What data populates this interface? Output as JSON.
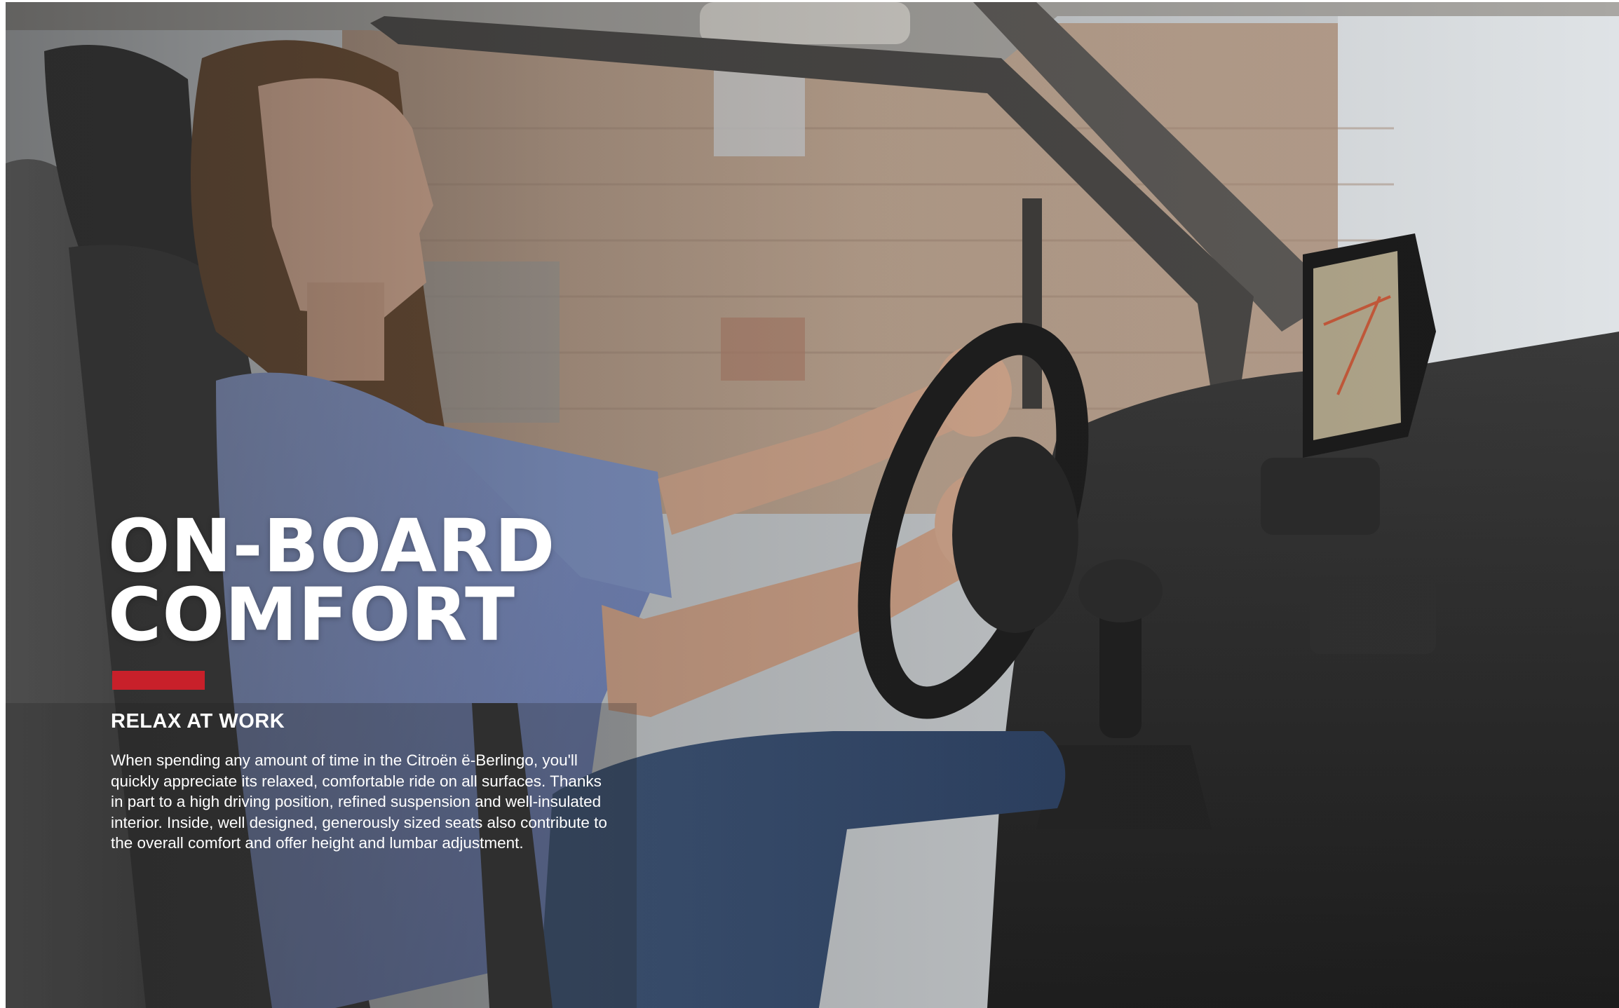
{
  "headline": {
    "line1": "ON-BOARD",
    "line2": "COMFORT"
  },
  "accent_color": "#c8202a",
  "subheading": "RELAX AT WORK",
  "body_lines": [
    "When spending any amount of time in the Citroën ë-Berlingo, you'll",
    "quickly appreciate its relaxed, comfortable ride on all surfaces. Thanks",
    "in part to a high driving position, refined suspension and well-insulated",
    "interior. Inside, well designed, generously sized seats also contribute to",
    "the overall comfort and offer height and lumbar adjustment."
  ],
  "photo": {
    "icons": [
      "steering-wheel-icon",
      "gear-shift-icon",
      "touchscreen-display-icon"
    ]
  }
}
